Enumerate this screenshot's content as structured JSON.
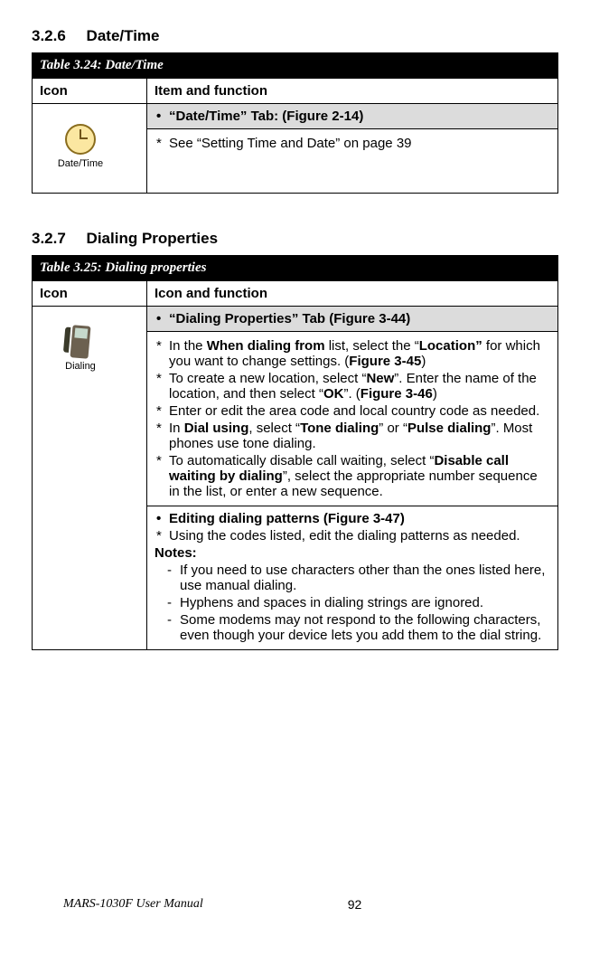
{
  "section1": {
    "number": "3.2.6",
    "title": "Date/Time"
  },
  "table1": {
    "caption": "Table 3.24: Date/Time",
    "headers": {
      "col1": "Icon",
      "col2": "Item and function"
    },
    "iconLabel": "Date/Time",
    "row1": "“Date/Time” Tab: (Figure 2-14)",
    "row2_item1": "See “Setting Time and Date” on page 39"
  },
  "section2": {
    "number": "3.2.7",
    "title": "Dialing Properties"
  },
  "table2": {
    "caption": "Table 3.25: Dialing properties",
    "headers": {
      "col1": "Icon",
      "col2": "Icon and function"
    },
    "iconLabel": "Dialing",
    "row1": "“Dialing Properties” Tab (Figure 3-44)",
    "r2_i1_pre": "In the ",
    "r2_i1_b1": "When dialing from",
    "r2_i1_mid": " list, select the “",
    "r2_i1_b2": "Location”",
    "r2_i1_post": " for which you want to change settings. (",
    "r2_i1_b3": "Figure 3-45",
    "r2_i1_end": ")",
    "r2_i2_pre": "To create a new location, select “",
    "r2_i2_b1": "New",
    "r2_i2_mid": "”. Enter the name of the location, and then select “",
    "r2_i2_b2": "OK",
    "r2_i2_post": "”. (",
    "r2_i2_b3": "Figure 3-46",
    "r2_i2_end": ")",
    "r2_i3": "Enter or edit the area code and local country code as needed.",
    "r2_i4_pre": "In ",
    "r2_i4_b1": "Dial using",
    "r2_i4_mid1": ", select “",
    "r2_i4_b2": "Tone dialing",
    "r2_i4_mid2": "” or “",
    "r2_i4_b3": "Pulse dialing",
    "r2_i4_post": "”. Most phones use tone dialing.",
    "r2_i5_pre": "To automatically disable call waiting, select “",
    "r2_i5_b1": "Disable call waiting by dialing",
    "r2_i5_post": "”, select the appropriate number sequence in the list, or enter a new sequence.",
    "r3_title": "Editing dialing patterns (Figure 3-47)",
    "r3_i1": "Using the codes listed, edit the dialing patterns as needed.",
    "r3_notes": "Notes:",
    "r3_d1": "If you need to use characters other than the ones listed here, use manual dialing.",
    "r3_d2": "Hyphens and spaces in dialing strings are ignored.",
    "r3_d3": "Some modems may not respond to the following characters, even though your device lets you add them to the dial string."
  },
  "footer": {
    "left": "MARS-1030F User Manual",
    "page": "92"
  }
}
